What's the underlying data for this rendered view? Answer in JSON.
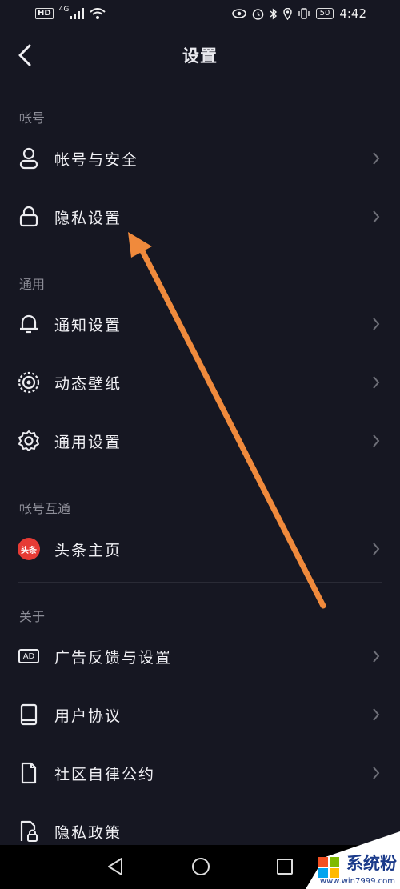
{
  "status_bar": {
    "hd": "HD",
    "network": "4G",
    "battery": "50",
    "time": "4:42"
  },
  "header": {
    "title": "设置"
  },
  "sections": {
    "account": {
      "label": "帐号",
      "items": [
        {
          "label": "帐号与安全",
          "icon": "person-icon"
        },
        {
          "label": "隐私设置",
          "icon": "lock-icon"
        }
      ]
    },
    "general": {
      "label": "通用",
      "items": [
        {
          "label": "通知设置",
          "icon": "bell-icon"
        },
        {
          "label": "动态壁纸",
          "icon": "live-wallpaper-icon"
        },
        {
          "label": "通用设置",
          "icon": "gear-icon"
        }
      ]
    },
    "interop": {
      "label": "帐号互通",
      "items": [
        {
          "label": "头条主页",
          "icon": "toutiao-icon",
          "icon_text": "头条"
        }
      ]
    },
    "about": {
      "label": "关于",
      "items": [
        {
          "label": "广告反馈与设置",
          "icon": "ad-icon",
          "icon_text": "AD"
        },
        {
          "label": "用户协议",
          "icon": "book-icon"
        },
        {
          "label": "社区自律公约",
          "icon": "document-icon"
        },
        {
          "label": "隐私政策",
          "icon": "privacy-doc-icon"
        }
      ]
    }
  },
  "watermark": {
    "text": "系统粉",
    "url": "www.win7999.com"
  },
  "colors": {
    "background": "#161722",
    "annotation_arrow": "#f08a3c",
    "toutiao_red": "#e63b35"
  }
}
